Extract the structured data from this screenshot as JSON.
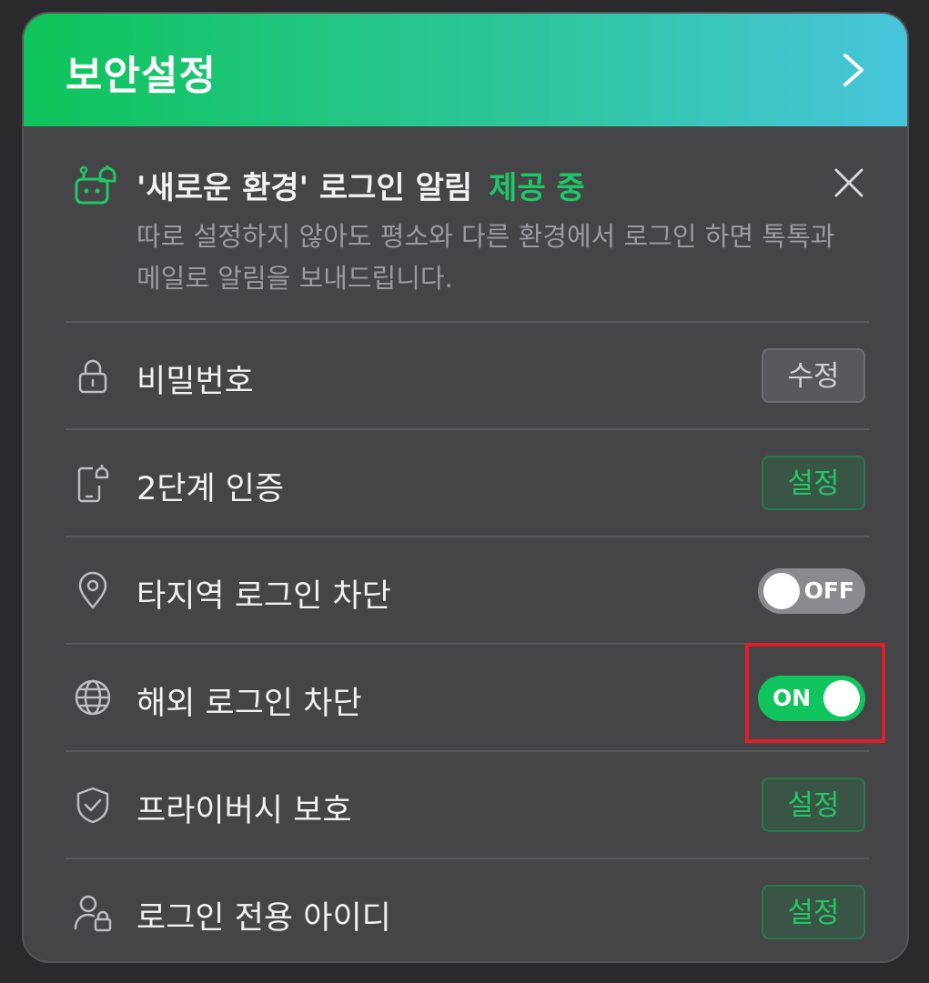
{
  "header": {
    "title": "보안설정",
    "chevron_icon": "chevron-right-icon"
  },
  "notice": {
    "icon": "robot-bell-icon",
    "title": "'새로운 환경' 로그인 알림",
    "status": "제공 중",
    "description": "따로 설정하지 않아도 평소와 다른 환경에서 로그인 하면 톡톡과 메일로 알림을 보내드립니다.",
    "close_icon": "close-icon"
  },
  "rows": [
    {
      "icon": "lock-icon",
      "label": "비밀번호",
      "button": "수정"
    },
    {
      "icon": "phone-lock-icon",
      "label": "2단계 인증",
      "button": "설정"
    },
    {
      "icon": "location-pin-icon",
      "label": "타지역 로그인 차단",
      "toggle": "OFF"
    },
    {
      "icon": "globe-icon",
      "label": "해외 로그인 차단",
      "toggle": "ON"
    },
    {
      "icon": "shield-check-icon",
      "label": "프라이버시 보호",
      "button": "설정"
    },
    {
      "icon": "user-lock-icon",
      "label": "로그인 전용 아이디",
      "button": "설정"
    }
  ],
  "colors": {
    "accent_green": "#1ec866",
    "highlight_red": "#e01e2b"
  }
}
